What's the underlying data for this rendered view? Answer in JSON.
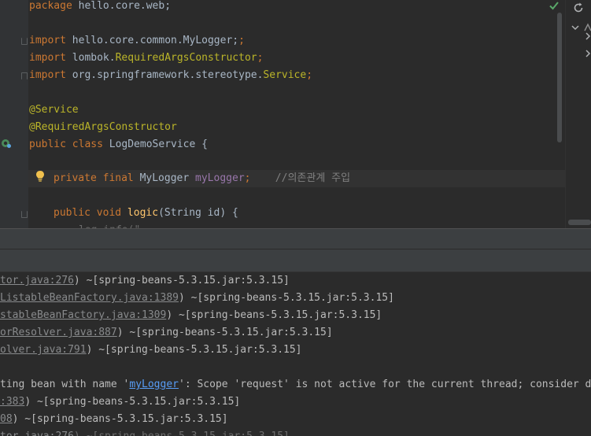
{
  "editor": {
    "lines": {
      "l1": {
        "kw": "package",
        "rest": " hello.core.web;"
      },
      "l3": {
        "kw": "import",
        "rest": " hello.core.common.MyLogger;"
      },
      "l4": {
        "kw": "import",
        "mid": " lombok.",
        "cls": "RequiredArgsConstructor",
        "semi": ";"
      },
      "l5": {
        "kw": "import",
        "mid": " org.springframework.stereotype.",
        "cls": "Service",
        "semi": ";"
      },
      "l7": {
        "ann": "@Service"
      },
      "l8": {
        "ann": "@RequiredArgsConstructor"
      },
      "l9": {
        "kw": "public class",
        "rest": " LogDemoService {"
      },
      "l11": {
        "kw": "private final",
        "type": " MyLogger ",
        "fld": "myLogger",
        "semi": ";",
        "comment": "//의존관계 주입"
      },
      "l13": {
        "kw": "public void",
        "fn": "logic",
        "rest": "(String id) {"
      }
    }
  },
  "console": {
    "lines": [
      {
        "link": "tor.java:276",
        "rest": ") ~[spring-beans-5.3.15.jar:5.3.15]"
      },
      {
        "link": "ListableBeanFactory.java:1389",
        "rest": ") ~[spring-beans-5.3.15.jar:5.3.15]"
      },
      {
        "link": "stableBeanFactory.java:1309",
        "rest": ") ~[spring-beans-5.3.15.jar:5.3.15]"
      },
      {
        "link": "orResolver.java:887",
        "rest": ") ~[spring-beans-5.3.15.jar:5.3.15]"
      },
      {
        "link": "olver.java:791",
        "rest": ") ~[spring-beans-5.3.15.jar:5.3.15]"
      }
    ],
    "error": {
      "pre": "ting bean with name '",
      "link": "myLogger",
      "post": "': Scope 'request' is not active for the current thread; consider de"
    },
    "after": [
      {
        "link": ":383",
        "rest": ") ~[spring-beans-5.3.15.jar:5.3.15]"
      },
      {
        "link": "08",
        "rest": ") ~[spring-beans-5.3.15.jar:5.3.15]"
      }
    ]
  },
  "icons": {
    "check": "check-icon",
    "refresh": "refresh-icon",
    "bean": "spring-bean-icon",
    "bulb": "lightbulb-icon"
  },
  "colors": {
    "keyword": "#cc7832",
    "annotation": "#bbb529",
    "field": "#9876aa",
    "method": "#ffc66d",
    "comment": "#808080",
    "text": "#a9b7c6",
    "link": "#589df6"
  }
}
